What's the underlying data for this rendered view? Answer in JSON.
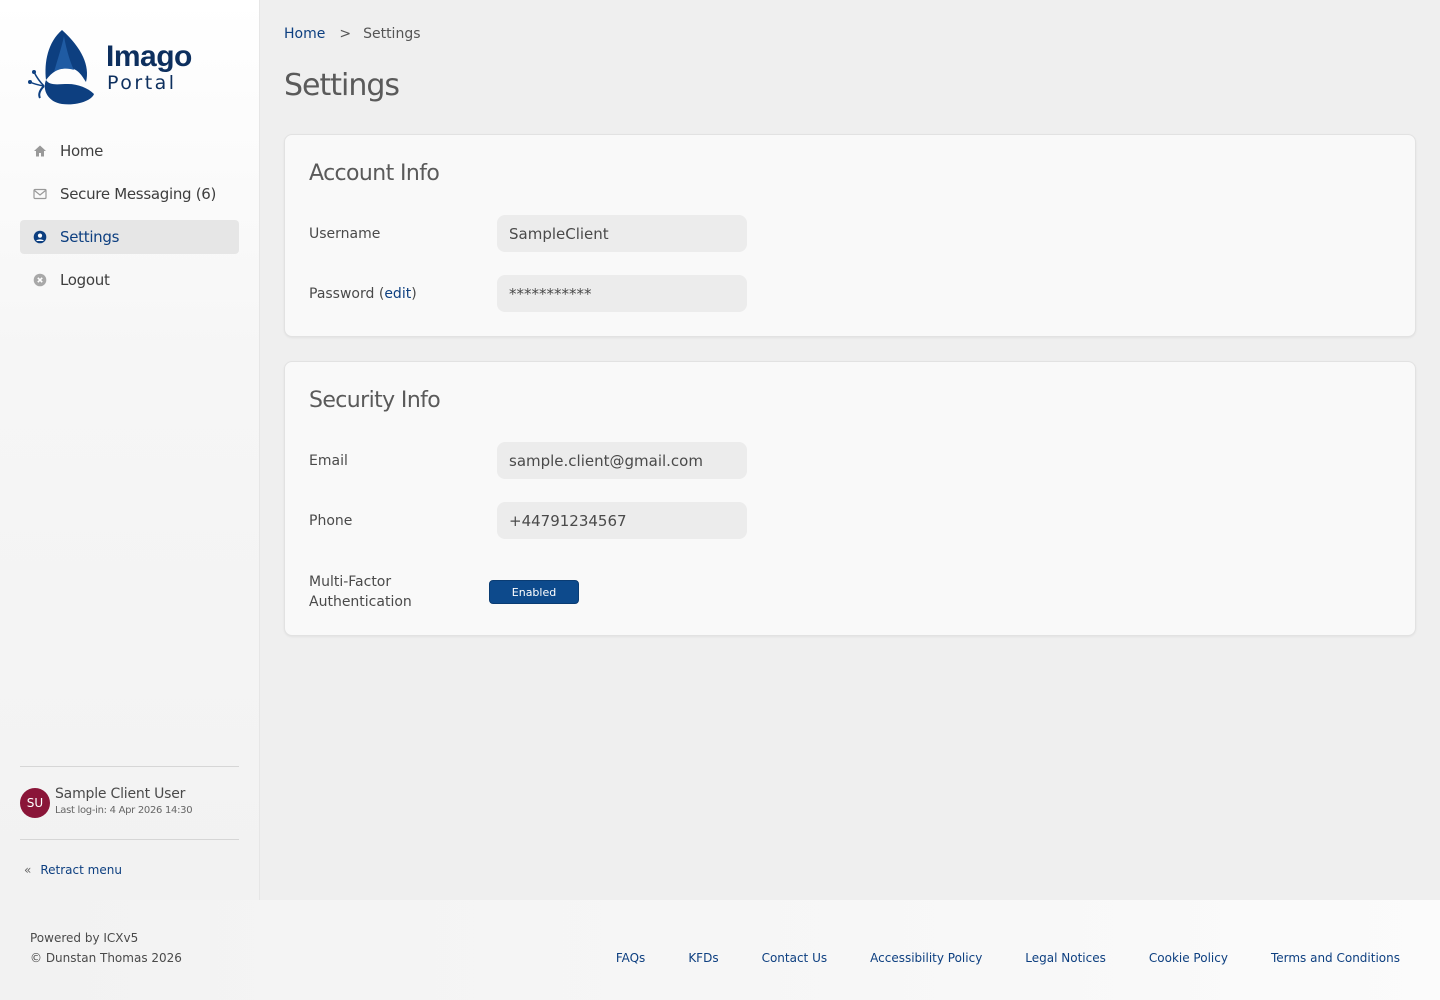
{
  "brand": {
    "name_line1": "Imago",
    "name_line2": "Portal"
  },
  "sidebar": {
    "items": [
      {
        "label": "Home",
        "icon": "home-icon"
      },
      {
        "label": "Secure Messaging (6)",
        "icon": "envelope-icon"
      },
      {
        "label": "Settings",
        "icon": "user-circle-icon",
        "active": true
      },
      {
        "label": "Logout",
        "icon": "close-circle-icon"
      }
    ],
    "user": {
      "initials": "SU",
      "name": "Sample Client User",
      "last_login": "Last log-in: 4 Apr 2026 14:30"
    },
    "retract_label": "Retract menu"
  },
  "breadcrumb": {
    "home": "Home",
    "separator": ">",
    "current": "Settings"
  },
  "page_title": "Settings",
  "account_info": {
    "title": "Account Info",
    "username_label": "Username",
    "username_value": "SampleClient",
    "password_label": "Password (",
    "password_edit": "edit",
    "password_close": ")",
    "password_value": "***********"
  },
  "security_info": {
    "title": "Security Info",
    "email_label": "Email",
    "email_value": "sample.client@gmail.com",
    "phone_label": "Phone",
    "phone_value": "+44791234567",
    "mfa_label_1": "Multi-Factor",
    "mfa_label_2": "Authentication",
    "mfa_status": "Enabled"
  },
  "footer": {
    "powered": "Powered by ICXv5",
    "copyright": "© Dunstan Thomas 2026",
    "links": [
      "FAQs",
      "KFDs",
      "Contact Us",
      "Accessibility Policy",
      "Legal Notices",
      "Cookie Policy",
      "Terms and Conditions"
    ]
  },
  "colors": {
    "accent": "#0d3f80",
    "badge": "#0d4a8c",
    "avatar": "#8a1538",
    "logo": "#0d2f5e"
  }
}
